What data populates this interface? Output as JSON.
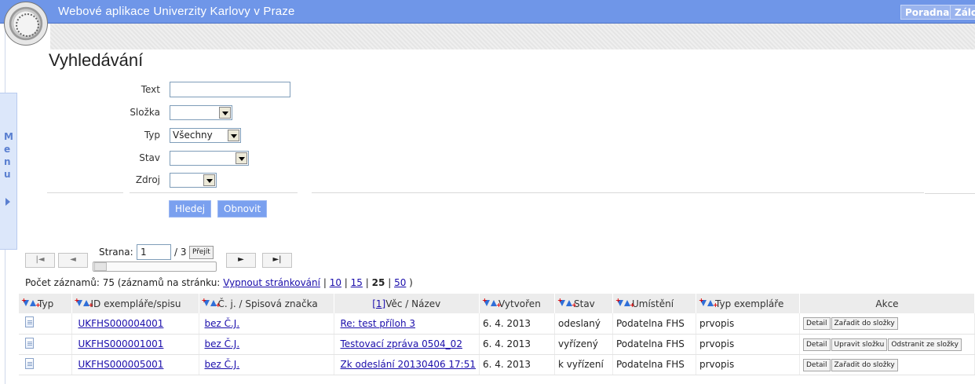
{
  "header": {
    "title": "Webové aplikace Univerzity Karlovy v Praze",
    "buttons": [
      "Poradna",
      "Zálo"
    ],
    "logo": "university-seal-icon"
  },
  "side_menu": {
    "letters": [
      "M",
      "e",
      "n",
      "u"
    ]
  },
  "page_title": "Vyhledávání",
  "form": {
    "text_label": "Text",
    "text_value": "",
    "folder_label": "Složka",
    "folder_value": "",
    "type_label": "Typ",
    "type_value": "Všechny",
    "state_label": "Stav",
    "state_value": "",
    "source_label": "Zdroj",
    "source_value": "",
    "search_button": "Hledej",
    "refresh_button": "Obnovit"
  },
  "pager": {
    "page_label": "Strana:",
    "page_value": "1",
    "total": "/ 3",
    "go_button": "Přejít",
    "first_icon": "first-page-icon",
    "prev_icon": "prev-page-icon",
    "next_icon": "next-page-icon",
    "last_icon": "last-page-icon"
  },
  "count": {
    "prefix": "Počet záznamů: 75 (záznamů na stránku:",
    "disable_link": "Vypnout stránkování",
    "opt10": "10",
    "opt15": "15",
    "current": "25",
    "opt50": "50",
    "sep": "|",
    "suffix": ")"
  },
  "table": {
    "headers": {
      "type": "Typ",
      "id": "ID exempláře/spisu",
      "cj": "Č. j. / Spisová značka",
      "subject_num": "[1]",
      "subject": "Věc / Název",
      "created": "Vytvořen",
      "state": "Stav",
      "location": "Umístění",
      "copy_type": "Typ exempláře",
      "actions": "Akce"
    },
    "rows": [
      {
        "id": "UKFHS000004001",
        "cj": "bez Č.J.",
        "subject": "Re: test příloh 3",
        "created": "6. 4. 2013",
        "state": "odeslaný",
        "location": "Podatelna FHS",
        "copy_type": "prvopis",
        "actions": [
          "Detail",
          "Zařadit do složky"
        ]
      },
      {
        "id": "UKFHS000001001",
        "cj": "bez Č.J.",
        "subject": "Testovací zpráva 0504_02",
        "created": "6. 4. 2013",
        "state": "vyřízený",
        "location": "Podatelna FHS",
        "copy_type": "prvopis",
        "actions": [
          "Detail",
          "Upravit složku",
          "Odstranit ze složky"
        ]
      },
      {
        "id": "UKFHS000005001",
        "cj": "bez Č.J.",
        "subject": "Zk odeslání 20130406 17:51",
        "created": "6. 4. 2013",
        "state": "k vyřízení",
        "location": "Podatelna FHS",
        "copy_type": "prvopis",
        "actions": [
          "Detail",
          "Zařadit do složky"
        ]
      }
    ]
  },
  "colors": {
    "header_blue": "#6f96e8",
    "button_blue": "#7aa0ef",
    "link": "#1a0dab",
    "sort_blue": "#2f6fd8",
    "sort_red": "#dd0000"
  }
}
